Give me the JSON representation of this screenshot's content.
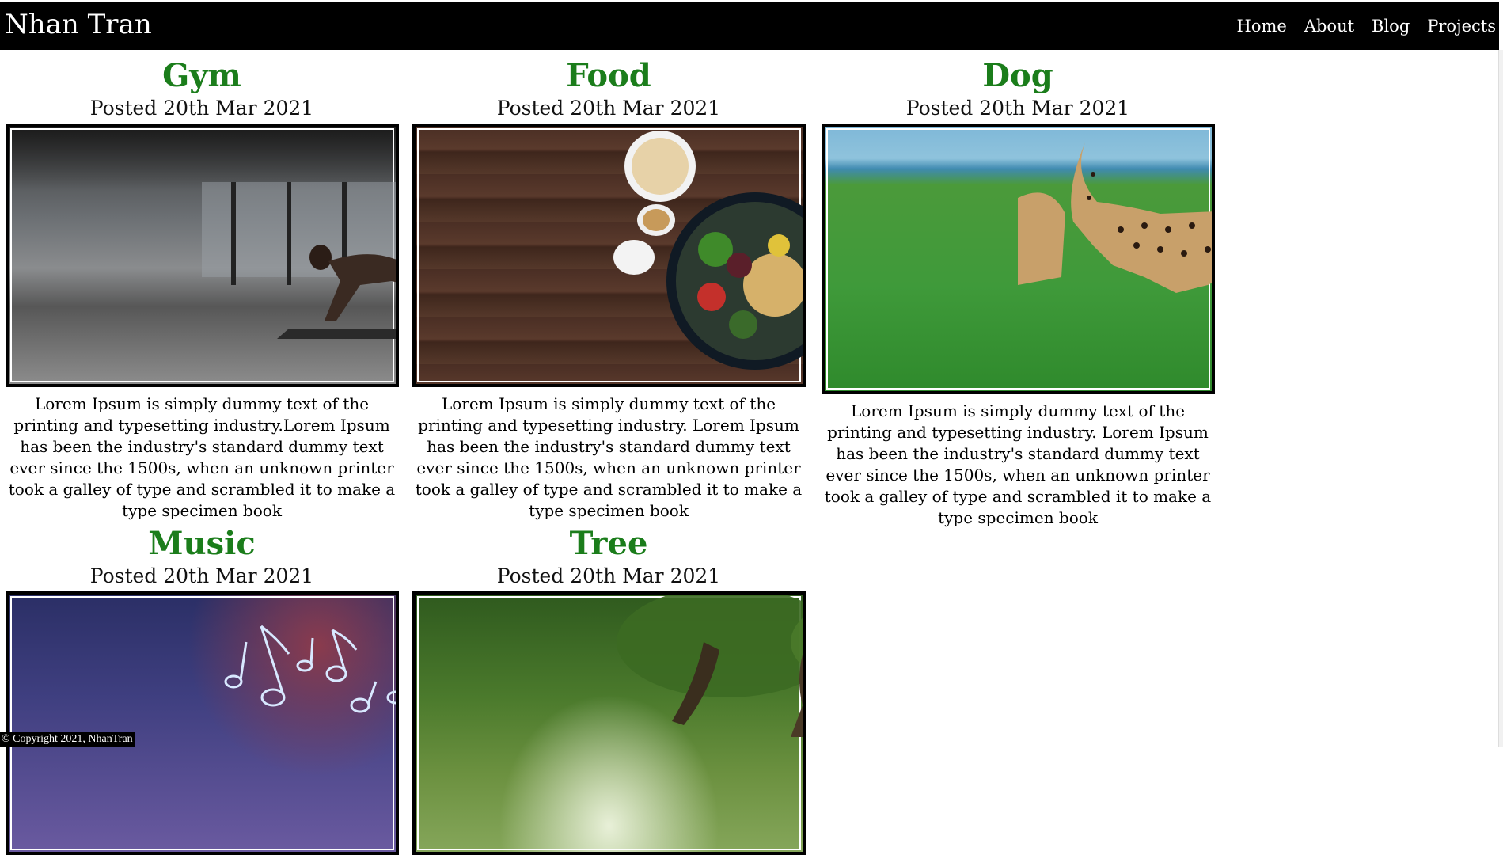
{
  "site": {
    "brand": "Nhan Tran",
    "nav": [
      "Home",
      "About",
      "Blog",
      "Projects"
    ]
  },
  "posts": [
    {
      "title": "Gym",
      "date": "Posted 20th Mar 2021",
      "text": "Lorem Ipsum is simply dummy text of the printing and typesetting industry.Lorem Ipsum has been the industry's standard dummy text ever since the 1500s, when an unknown printer took a galley of type and scrambled it to make a type specimen book"
    },
    {
      "title": "Food",
      "date": "Posted 20th Mar 2021",
      "text": "Lorem Ipsum is simply dummy text of the printing and typesetting industry. Lorem Ipsum has been the industry's standard dummy text ever since the 1500s, when an unknown printer took a galley of type and scrambled it to make a type specimen book"
    },
    {
      "title": "Dog",
      "date": "Posted 20th Mar 2021",
      "text": "Lorem Ipsum is simply dummy text of the printing and typesetting industry. Lorem Ipsum has been the industry's standard dummy text ever since the 1500s, when an unknown printer took a galley of type and scrambled it to make a type specimen book"
    },
    {
      "title": "Music",
      "date": "Posted 20th Mar 2021"
    },
    {
      "title": "Tree",
      "date": "Posted 20th Mar 2021"
    }
  ],
  "footer": {
    "text": "© Copyright 2021, NhanTran"
  },
  "colors": {
    "navbar": "#000000",
    "post_title": "#1b7d1b"
  }
}
